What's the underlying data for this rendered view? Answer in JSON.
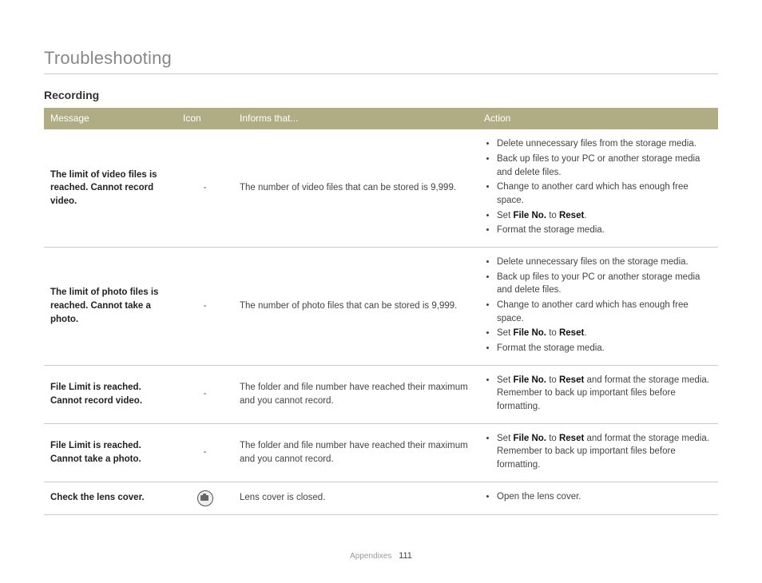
{
  "page_title": "Troubleshooting",
  "section": "Recording",
  "footer": {
    "section": "Appendixes",
    "page": "111"
  },
  "headers": {
    "message": "Message",
    "icon": "Icon",
    "informs": "Informs that...",
    "action": "Action"
  },
  "strings": {
    "file_no": "File No.",
    "reset": "Reset"
  },
  "rows": [
    {
      "message": "The limit of video files is reached. Cannot record video.",
      "icon_type": "dash",
      "informs": "The number of video files that can be stored is 9,999.",
      "actions": [
        {
          "text": "Delete unnecessary files from the storage media."
        },
        {
          "text": "Back up files to your PC or another storage media and delete files."
        },
        {
          "text": "Change to another card which has enough free space."
        },
        {
          "type": "set_fileno_reset",
          "prefix": "Set ",
          "suffix": "."
        },
        {
          "text": "Format the storage media."
        }
      ]
    },
    {
      "message": "The limit of photo files is reached. Cannot take a photo.",
      "icon_type": "dash",
      "informs": "The number of photo files that can be stored is 9,999.",
      "actions": [
        {
          "text": "Delete unnecessary files on the storage media."
        },
        {
          "text": "Back up files to your PC or another storage media and delete files."
        },
        {
          "text": "Change to another card which has enough free space."
        },
        {
          "type": "set_fileno_reset",
          "prefix": "Set ",
          "suffix": "."
        },
        {
          "text": "Format the storage media."
        }
      ]
    },
    {
      "message": "File Limit is reached. Cannot record video.",
      "icon_type": "dash",
      "informs": "The folder and file number have reached their maximum and you cannot record.",
      "actions": [
        {
          "type": "set_fileno_reset_format",
          "prefix": "Set ",
          "middle": " and format the storage media. Remember to back up important files before formatting."
        }
      ]
    },
    {
      "message": "File Limit is reached. Cannot take a photo.",
      "icon_type": "dash",
      "informs": "The folder and file number have reached their maximum and you cannot record.",
      "actions": [
        {
          "type": "set_fileno_reset_format",
          "prefix": "Set ",
          "middle": " and format the storage media. Remember to back up important files before formatting."
        }
      ]
    },
    {
      "message": "Check the lens cover.",
      "icon_type": "lens",
      "informs": "Lens cover is closed.",
      "actions": [
        {
          "text": "Open the lens cover."
        }
      ]
    }
  ]
}
